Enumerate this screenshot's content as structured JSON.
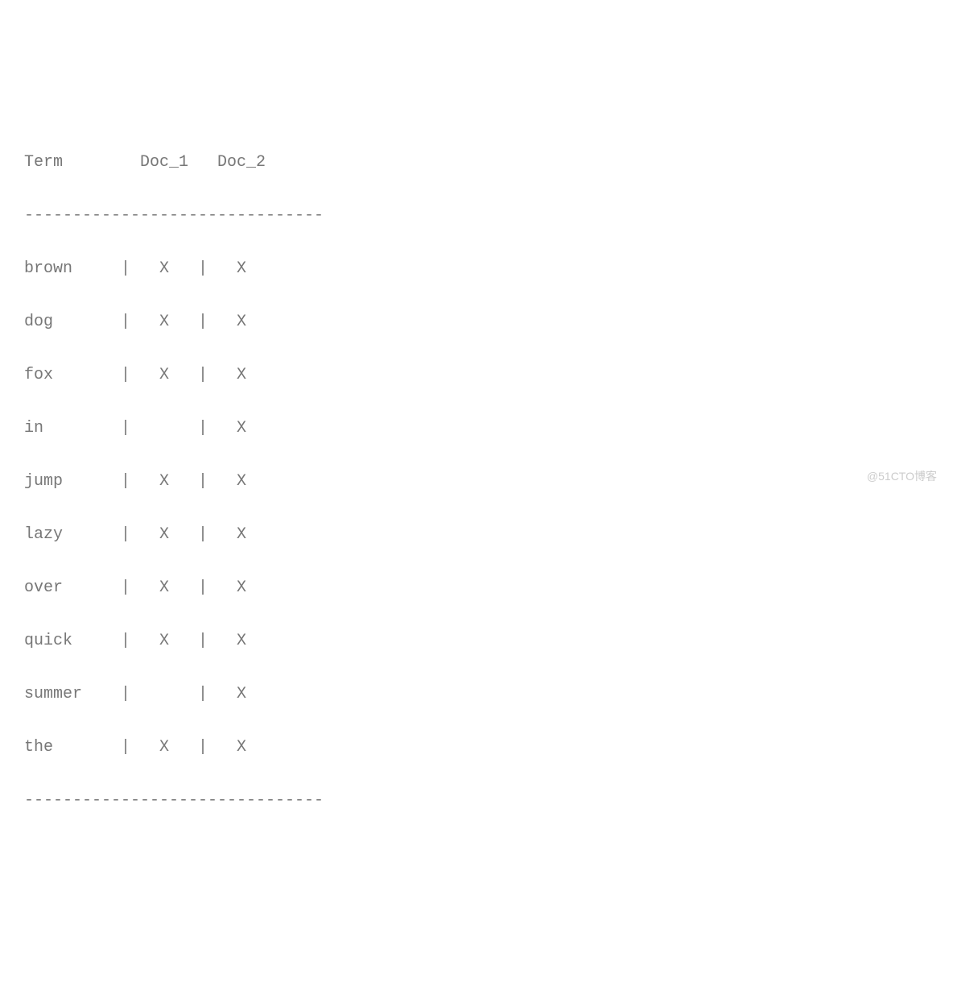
{
  "chart_data": {
    "type": "table",
    "title": "",
    "columns": [
      "Term",
      "Doc_1",
      "Doc_2"
    ],
    "rows": [
      {
        "term": "brown",
        "doc_1": "X",
        "doc_2": "X"
      },
      {
        "term": "dog",
        "doc_1": "X",
        "doc_2": "X"
      },
      {
        "term": "fox",
        "doc_1": "X",
        "doc_2": "X"
      },
      {
        "term": "in",
        "doc_1": "",
        "doc_2": "X"
      },
      {
        "term": "jump",
        "doc_1": "X",
        "doc_2": "X"
      },
      {
        "term": "lazy",
        "doc_1": "X",
        "doc_2": "X"
      },
      {
        "term": "over",
        "doc_1": "X",
        "doc_2": "X"
      },
      {
        "term": "quick",
        "doc_1": "X",
        "doc_2": "X"
      },
      {
        "term": "summer",
        "doc_1": "",
        "doc_2": "X"
      },
      {
        "term": "the",
        "doc_1": "X",
        "doc_2": "X"
      }
    ]
  },
  "header": {
    "col0": "Term",
    "col1": "Doc_1",
    "col2": "Doc_2"
  },
  "divider": "-------------------------------",
  "separator": "|",
  "rows": [
    {
      "term": "brown",
      "doc_1": "X",
      "doc_2": "X"
    },
    {
      "term": "dog",
      "doc_1": "X",
      "doc_2": "X"
    },
    {
      "term": "fox",
      "doc_1": "X",
      "doc_2": "X"
    },
    {
      "term": "in",
      "doc_1": " ",
      "doc_2": "X"
    },
    {
      "term": "jump",
      "doc_1": "X",
      "doc_2": "X"
    },
    {
      "term": "lazy",
      "doc_1": "X",
      "doc_2": "X"
    },
    {
      "term": "over",
      "doc_1": "X",
      "doc_2": "X"
    },
    {
      "term": "quick",
      "doc_1": "X",
      "doc_2": "X"
    },
    {
      "term": "summer",
      "doc_1": " ",
      "doc_2": "X"
    },
    {
      "term": "the",
      "doc_1": "X",
      "doc_2": "X"
    }
  ],
  "watermark": "@51CTO博客"
}
